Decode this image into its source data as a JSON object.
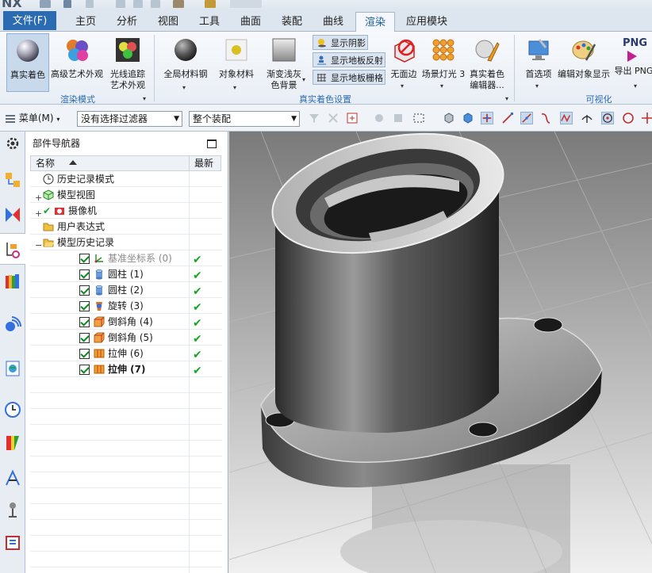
{
  "app": {
    "logo": "NX"
  },
  "tabs": [
    {
      "label": "文件(F)",
      "state": "file"
    },
    {
      "label": "主页"
    },
    {
      "label": "分析"
    },
    {
      "label": "视图"
    },
    {
      "label": "工具"
    },
    {
      "label": "曲面"
    },
    {
      "label": "装配"
    },
    {
      "label": "曲线"
    },
    {
      "label": "渲染",
      "state": "active"
    },
    {
      "label": "应用模块"
    }
  ],
  "ribbon": {
    "render_mode": {
      "group_label": "渲染模式",
      "buttons": [
        {
          "label": "真实着色",
          "icon": "sphere-shaded-icon",
          "selected": true
        },
        {
          "label": "高级艺术外观",
          "icon": "art-spheres-icon"
        },
        {
          "label": "光线追踪",
          "label2": "艺术外观",
          "icon": "ray-trace-icon"
        }
      ]
    },
    "shading_settings": {
      "group_label": "真实着色设置",
      "buttons": [
        {
          "label": "全局材料钢",
          "icon": "global-material-icon"
        },
        {
          "label": "对象材料",
          "icon": "object-material-icon"
        },
        {
          "label": "渐变浅灰",
          "label2": "色背景",
          "icon": "gradient-background-icon"
        }
      ],
      "toggles": [
        {
          "label": "显示阴影",
          "icon": "shadow-icon"
        },
        {
          "label": "显示地板反射",
          "icon": "floor-reflection-icon"
        },
        {
          "label": "显示地板栅格",
          "icon": "floor-grid-icon"
        }
      ],
      "more_buttons": [
        {
          "label": "无面边",
          "icon": "no-face-edges-icon"
        },
        {
          "label": "场景灯光 3",
          "icon": "scene-lights-icon"
        },
        {
          "label": "真实着色",
          "label2": "编辑器...",
          "icon": "shading-editor-icon"
        }
      ]
    },
    "visualize": {
      "group_label": "可视化",
      "buttons": [
        {
          "label": "首选项",
          "icon": "preferences-icon"
        },
        {
          "label": "编辑对象显示",
          "icon": "edit-object-display-icon"
        },
        {
          "label": "导出 PNG",
          "icon": "export-png-icon",
          "badge": "PNG"
        }
      ]
    }
  },
  "commandbar": {
    "menu_label": "菜单(M)",
    "filter_value": "没有选择过滤器",
    "scope_value": "整个装配"
  },
  "navigator": {
    "title": "部件导航器",
    "col_name": "名称",
    "col_latest": "最新",
    "rows": [
      {
        "label": "历史记录模式",
        "icon": "clock-icon",
        "indent": 0,
        "expander": "",
        "checkbox": false,
        "latest": false,
        "style": ""
      },
      {
        "label": "模型视图",
        "icon": "model-views-icon",
        "indent": 0,
        "expander": "+",
        "checkbox": false,
        "latest": false,
        "style": ""
      },
      {
        "label": "摄像机",
        "icon": "camera-icon",
        "indent": 0,
        "expander": "+",
        "checkbox": false,
        "latest": false,
        "style": ""
      },
      {
        "label": "用户表达式",
        "icon": "folder-icon",
        "indent": 0,
        "expander": "",
        "checkbox": false,
        "latest": false,
        "style": ""
      },
      {
        "label": "模型历史记录",
        "icon": "folder-open-icon",
        "indent": 0,
        "expander": "−",
        "checkbox": false,
        "latest": false,
        "style": ""
      },
      {
        "label": "基准坐标系 (0)",
        "icon": "datum-csys-icon",
        "indent": 1,
        "expander": "",
        "checkbox": true,
        "latest": true,
        "style": "grey"
      },
      {
        "label": "圆柱 (1)",
        "icon": "cylinder-icon",
        "indent": 1,
        "expander": "",
        "checkbox": true,
        "latest": true,
        "style": ""
      },
      {
        "label": "圆柱 (2)",
        "icon": "cylinder-icon",
        "indent": 1,
        "expander": "",
        "checkbox": true,
        "latest": true,
        "style": ""
      },
      {
        "label": "旋转 (3)",
        "icon": "revolve-icon",
        "indent": 1,
        "expander": "",
        "checkbox": true,
        "latest": true,
        "style": ""
      },
      {
        "label": "倒斜角 (4)",
        "icon": "chamfer-icon",
        "indent": 1,
        "expander": "",
        "checkbox": true,
        "latest": true,
        "style": ""
      },
      {
        "label": "倒斜角 (5)",
        "icon": "chamfer-icon",
        "indent": 1,
        "expander": "",
        "checkbox": true,
        "latest": true,
        "style": ""
      },
      {
        "label": "拉伸 (6)",
        "icon": "extrude-icon",
        "indent": 1,
        "expander": "",
        "checkbox": true,
        "latest": true,
        "style": ""
      },
      {
        "label": "拉伸 (7)",
        "icon": "extrude-icon",
        "indent": 1,
        "expander": "",
        "checkbox": true,
        "latest": true,
        "style": "bold"
      }
    ]
  },
  "resource_bar": [
    "settings-icon",
    "assembly-navigator-icon",
    "constraint-navigator-icon",
    "part-navigator-icon",
    "reuse-library-icon",
    "hd3d-tools-icon",
    "web-browser-icon",
    "history-icon",
    "system-materials-icon",
    "process-studio-icon",
    "manufacturing-wizard-icon",
    "roles-icon"
  ],
  "colors": {
    "file_tab": "#2b6bb1",
    "accent": "#1f5fa8",
    "check": "#18a52a"
  }
}
